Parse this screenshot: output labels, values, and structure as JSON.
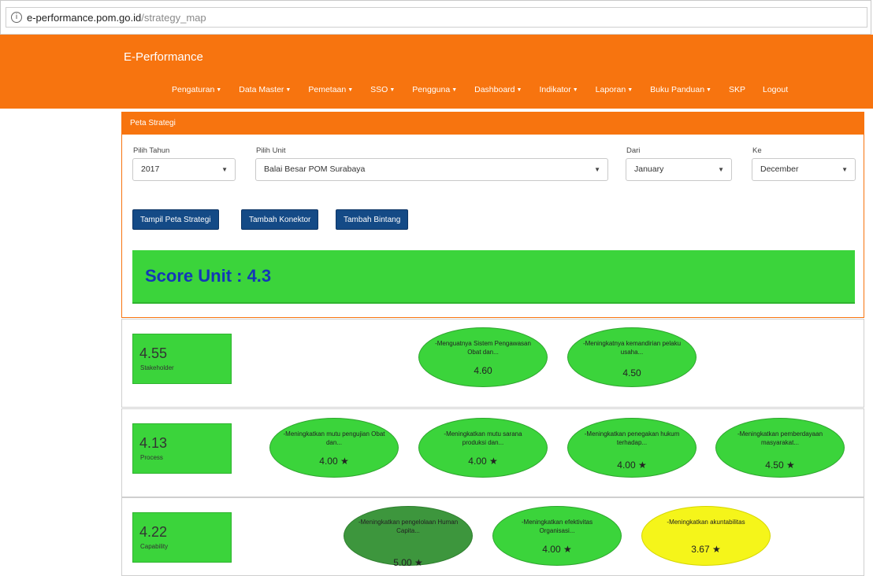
{
  "browser": {
    "url_host": "e-performance.pom.go.id",
    "url_path": "/strategy_map"
  },
  "navbar": {
    "brand": "E-Performance",
    "menu": [
      "Pengaturan",
      "Data Master",
      "Pemetaan",
      "SSO",
      "Pengguna",
      "Dashboard",
      "Indikator",
      "Laporan",
      "Buku Panduan",
      "SKP",
      "Logout"
    ],
    "menu_with_caret": [
      true,
      true,
      true,
      true,
      true,
      true,
      true,
      true,
      true,
      false,
      false
    ]
  },
  "panel": {
    "title": "Peta Strategi",
    "year_label": "Pilih Tahun",
    "year_value": "2017",
    "unit_label": "Pilih Unit",
    "unit_value": "Balai Besar POM Surabaya",
    "from_label": "Dari",
    "from_value": "January",
    "to_label": "Ke",
    "to_value": "December",
    "buttons": [
      "Tampil Peta Strategi",
      "Tambah Konektor",
      "Tambah Bintang"
    ],
    "score_text": "Score Unit : 4.3"
  },
  "perspectives": [
    {
      "value": "4.55",
      "name": "Stakeholder",
      "objectives": [
        {
          "text": "-Menguatnya Sistem Pengawasan Obat dan...",
          "score": "4.60"
        },
        {
          "text": "-Meningkatnya kemandirian pelaku usaha...",
          "score": "4.50"
        }
      ]
    },
    {
      "value": "4.13",
      "name": "Process",
      "objectives": [
        {
          "text": "-Meningkatkan mutu pengujian Obat dan...",
          "score": "4.00 ★"
        },
        {
          "text": "-Meningkatkan mutu sarana produksi dan...",
          "score": "4.00 ★"
        },
        {
          "text": "-Meningkatkan penegakan hukum terhadap...",
          "score": "4.00 ★"
        },
        {
          "text": "-Meningkatkan pemberdayaan masyarakat...",
          "score": "4.50 ★"
        }
      ]
    },
    {
      "value": "4.22",
      "name": "Capability",
      "objectives": [
        {
          "text": "-Meningkatkan pengelolaan Human Capita...",
          "score": "5.00 ★"
        },
        {
          "text": "-Meningkatkan efektivitas Organisasi...",
          "score": "4.00 ★"
        },
        {
          "text": "-Meningkatkan akuntabilitas",
          "score": "3.67 ★"
        }
      ]
    }
  ],
  "colors": {
    "navbar": "#f7740f",
    "button": "#144a86",
    "green": "#3bd43b",
    "dark_green": "#3d963d",
    "yellow": "#f5f51a",
    "score_text": "#1337b8"
  }
}
